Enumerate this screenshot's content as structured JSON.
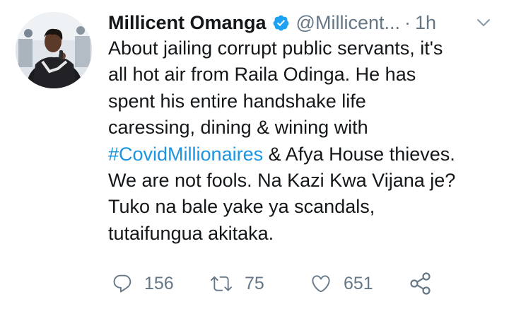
{
  "author": {
    "name": "Millicent Omanga",
    "handle": "@Millicent...",
    "separator": "·",
    "time": "1h",
    "verified": true
  },
  "tweet": {
    "lines": [
      "About jailing corrupt public servants, it's",
      "all hot air from Raila Odinga. He has",
      "spent his entire handshake life",
      "caressing, dining & wining with"
    ],
    "hashtag": "#CovidMillionaires",
    "hashtag_line_rest": " & Afya House thieves.",
    "lines_after": [
      "We are not fools. Na Kazi Kwa Vijana je?",
      "Tuko na bale yake ya scandals,",
      "tutaifungua akitaka."
    ]
  },
  "actions": {
    "reply_count": "156",
    "retweet_count": "75",
    "like_count": "651"
  },
  "icons": {
    "verified": "verified-badge-icon",
    "menu": "chevron-down-icon",
    "reply": "reply-icon",
    "retweet": "retweet-icon",
    "like": "heart-icon",
    "share": "share-icon"
  },
  "colors": {
    "text": "#14171a",
    "secondary": "#657786",
    "link": "#1b95e0",
    "verified": "#1da1f2"
  }
}
